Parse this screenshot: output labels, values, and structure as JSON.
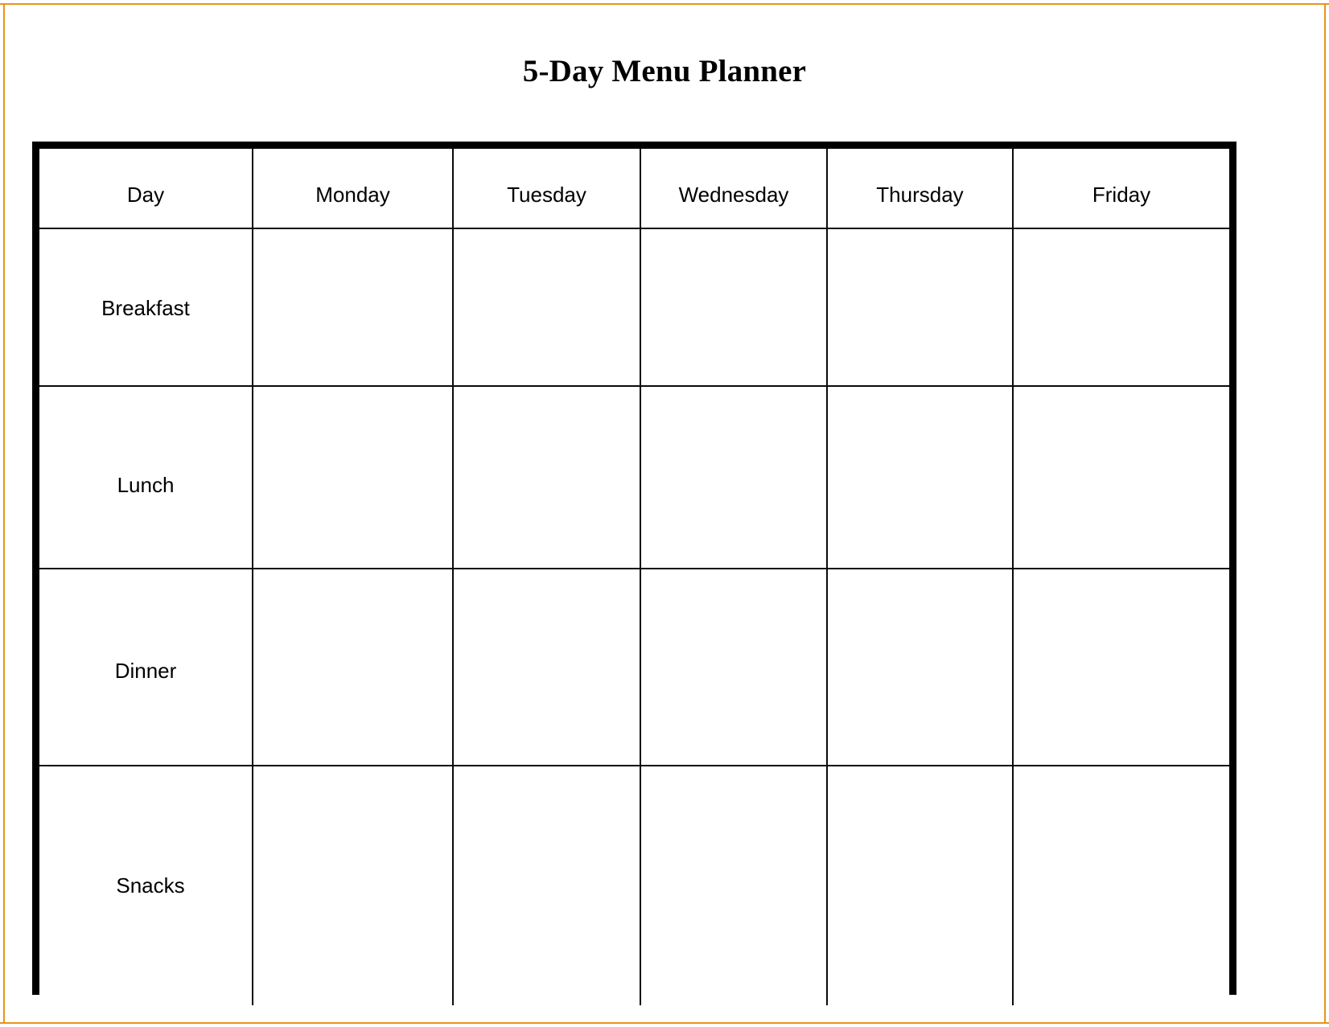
{
  "page": {
    "border_color": "#E8941B",
    "background": "#ffffff"
  },
  "title": "5-Day Menu Planner",
  "table": {
    "border_color": "#000000",
    "columns": [
      {
        "key": "label",
        "label": "Day"
      },
      {
        "key": "monday",
        "label": "Monday"
      },
      {
        "key": "tuesday",
        "label": "Tuesday"
      },
      {
        "key": "wednesday",
        "label": "Wednesday"
      },
      {
        "key": "thursday",
        "label": "Thursday"
      },
      {
        "key": "friday",
        "label": "Friday"
      }
    ],
    "rows": [
      {
        "label": "Breakfast",
        "monday": "",
        "tuesday": "",
        "wednesday": "",
        "thursday": "",
        "friday": ""
      },
      {
        "label": "Lunch",
        "monday": "",
        "tuesday": "",
        "wednesday": "",
        "thursday": "",
        "friday": ""
      },
      {
        "label": "Dinner",
        "monday": "",
        "tuesday": "",
        "wednesday": "",
        "thursday": "",
        "friday": ""
      },
      {
        "label": "Snacks",
        "monday": "",
        "tuesday": "",
        "wednesday": "",
        "thursday": "",
        "friday": ""
      }
    ]
  }
}
